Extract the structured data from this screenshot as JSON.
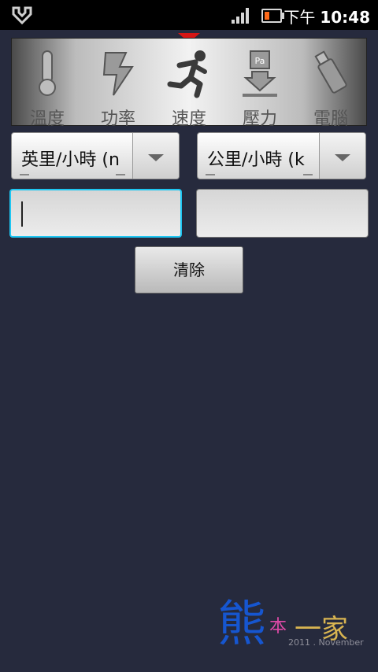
{
  "status_bar": {
    "time_ampm": "下午",
    "time": "10:48",
    "icons": [
      "usb-mode-icon",
      "signal-strength-icon",
      "battery-low-icon"
    ]
  },
  "categories": [
    {
      "label": "溫度",
      "icon": "thermometer-icon"
    },
    {
      "label": "功率",
      "icon": "power-bolt-icon"
    },
    {
      "label": "速度",
      "icon": "running-person-icon"
    },
    {
      "label": "壓力",
      "icon": "pressure-pa-icon"
    },
    {
      "label": "電腦",
      "icon": "usb-drive-icon"
    }
  ],
  "selected_category": "速度",
  "from_unit": {
    "value": "英里/小時 (n"
  },
  "to_unit": {
    "value": "公里/小時 (k"
  },
  "input": {
    "value": "",
    "placeholder": ""
  },
  "output": {
    "value": ""
  },
  "clear_button_label": "清除",
  "watermark": {
    "main": "熊",
    "small": "本",
    "family": "一家",
    "date": "2011 . November"
  },
  "colors": {
    "background": "#262a3d",
    "focus": "#1ec6f2",
    "selection_marker": "#d61515"
  }
}
